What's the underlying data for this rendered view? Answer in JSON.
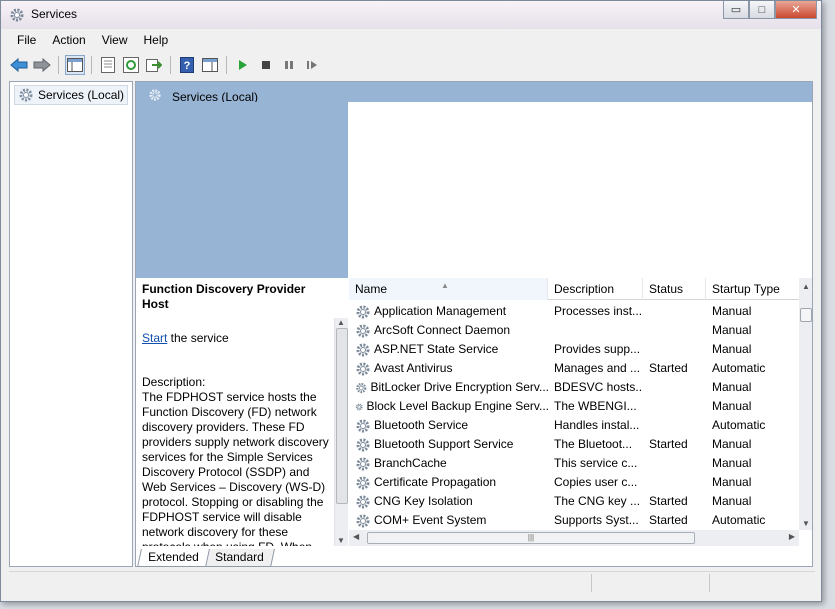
{
  "window": {
    "title": "Services",
    "controls": {
      "minimize": "▭",
      "maximize": "□",
      "close": "✕"
    }
  },
  "menu": [
    "File",
    "Action",
    "View",
    "Help"
  ],
  "toolbar": {
    "buttons": [
      "back-icon",
      "forward-icon",
      "show-hide-console-tree-icon",
      "properties-icon",
      "refresh-icon",
      "export-list-icon",
      "help-icon",
      "show-hide-action-pane-icon",
      "start-service-icon",
      "stop-service-icon",
      "pause-service-icon",
      "resume-service-icon"
    ]
  },
  "tree": {
    "root": "Services (Local)"
  },
  "panel_header": "Services (Local)",
  "detail": {
    "service_name": "Function Discovery Provider Host",
    "start_link": "Start",
    "start_suffix": " the service",
    "description_label": "Description:",
    "description": "The FDPHOST service hosts the Function Discovery (FD) network discovery providers. These FD providers supply network discovery services for the Simple Services Discovery Protocol (SSDP) and Web Services – Discovery (WS-D) protocol. Stopping or disabling the FDPHOST service will disable network discovery for these protocols when using FD. When this service is unavailable, network"
  },
  "columns": [
    "Name",
    "Description",
    "Status",
    "Startup Type"
  ],
  "services": [
    {
      "name": "Application Management",
      "description": "Processes inst...",
      "status": "",
      "startup": "Manual"
    },
    {
      "name": "ArcSoft Connect Daemon",
      "description": "",
      "status": "",
      "startup": "Manual"
    },
    {
      "name": "ASP.NET State Service",
      "description": "Provides supp...",
      "status": "",
      "startup": "Manual"
    },
    {
      "name": "Avast Antivirus",
      "description": "Manages and ...",
      "status": "Started",
      "startup": "Automatic"
    },
    {
      "name": "BitLocker Drive Encryption Serv...",
      "description": "BDESVC hosts...",
      "status": "",
      "startup": "Manual"
    },
    {
      "name": "Block Level Backup Engine Serv...",
      "description": "The WBENGI...",
      "status": "",
      "startup": "Manual"
    },
    {
      "name": "Bluetooth Service",
      "description": "Handles instal...",
      "status": "",
      "startup": "Automatic"
    },
    {
      "name": "Bluetooth Support Service",
      "description": "The Bluetoot...",
      "status": "Started",
      "startup": "Manual"
    },
    {
      "name": "BranchCache",
      "description": "This service c...",
      "status": "",
      "startup": "Manual"
    },
    {
      "name": "Certificate Propagation",
      "description": "Copies user c...",
      "status": "",
      "startup": "Manual"
    },
    {
      "name": "CNG Key Isolation",
      "description": "The CNG key ...",
      "status": "Started",
      "startup": "Manual"
    },
    {
      "name": "COM+ Event System",
      "description": "Supports Syst...",
      "status": "Started",
      "startup": "Automatic"
    }
  ],
  "tabs": [
    "Extended",
    "Standard"
  ],
  "colors": {
    "panel_blue": "#98b4d4",
    "link": "#0f4fae"
  }
}
